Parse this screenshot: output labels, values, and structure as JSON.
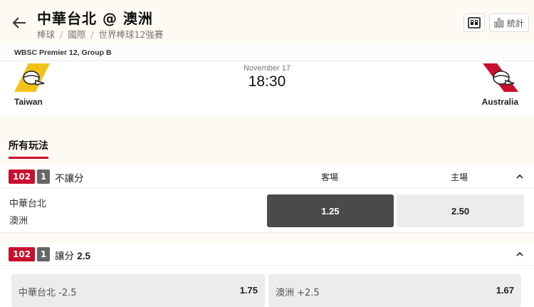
{
  "header": {
    "title": "中華台北 @ 澳洲",
    "breadcrumb": [
      "棒球",
      "國際",
      "世界棒球12強賽"
    ],
    "stats_label": "統計"
  },
  "match": {
    "league": "WBSC Premier 12, Group B",
    "date": "November 17",
    "time": "18:30",
    "home_team": "Taiwan",
    "away_team": "Australia",
    "home_color": "#f2c21b",
    "away_color": "#c8102e"
  },
  "tabs": {
    "all_label": "所有玩法"
  },
  "markets": [
    {
      "code": "102",
      "count": "1",
      "title": "不讓分",
      "col_away": "客場",
      "col_home": "主場",
      "teams": [
        "中華台北",
        "澳洲"
      ],
      "odds": [
        "1.25",
        "2.50"
      ],
      "selected": "1.25"
    },
    {
      "code": "102",
      "count": "1",
      "title": "讓分",
      "line": "2.5",
      "options": [
        {
          "label": "中華台北 -2.5",
          "odd": "1.75"
        },
        {
          "label": "澳洲 +2.5",
          "odd": "1.67"
        }
      ]
    }
  ],
  "colors": {
    "accent": "#c8102e",
    "selected": "#4a4a4a"
  }
}
